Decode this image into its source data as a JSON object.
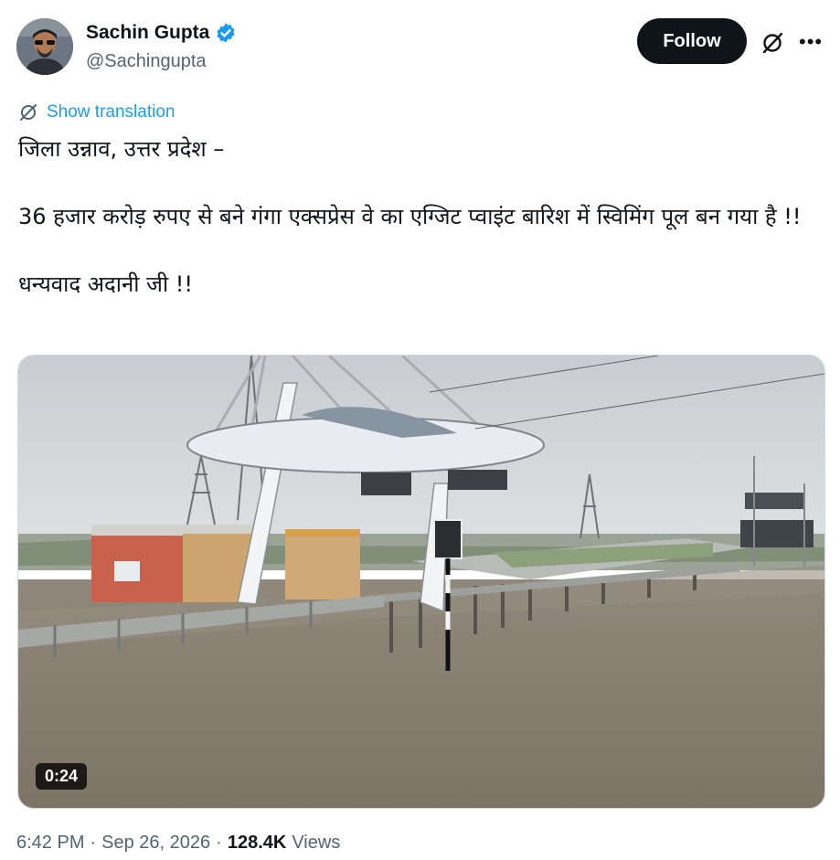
{
  "author": {
    "name": "Sachin Gupta",
    "handle": "@Sachingupta",
    "verified": true,
    "avatar_icon": "user-avatar-icon"
  },
  "actions": {
    "follow_label": "Follow",
    "more_icon": "more-horizontal-icon",
    "grok_icon": "grok-icon"
  },
  "translation": {
    "label": "Show translation"
  },
  "tweet": {
    "lines": [
      "जिला उन्नाव, उत्तर प्रदेश –",
      "36 हजार करोड़ रुपए से बने गंगा एक्सप्रेस वे का एग्जिट प्वाइंट बारिश में स्विमिंग पूल बन गया है !!",
      "धन्यवाद अदानी जी !!"
    ]
  },
  "media": {
    "type": "video",
    "duration": "0:24"
  },
  "meta": {
    "time": "6:42 PM",
    "separator": "·",
    "date": "Sep 26, 2026",
    "views_count": "128.4K",
    "views_label": "Views"
  },
  "colors": {
    "link": "#1d9bf0",
    "verified": "#1d9bf0",
    "follow_bg": "#0f1419",
    "secondary_text": "#536471"
  }
}
